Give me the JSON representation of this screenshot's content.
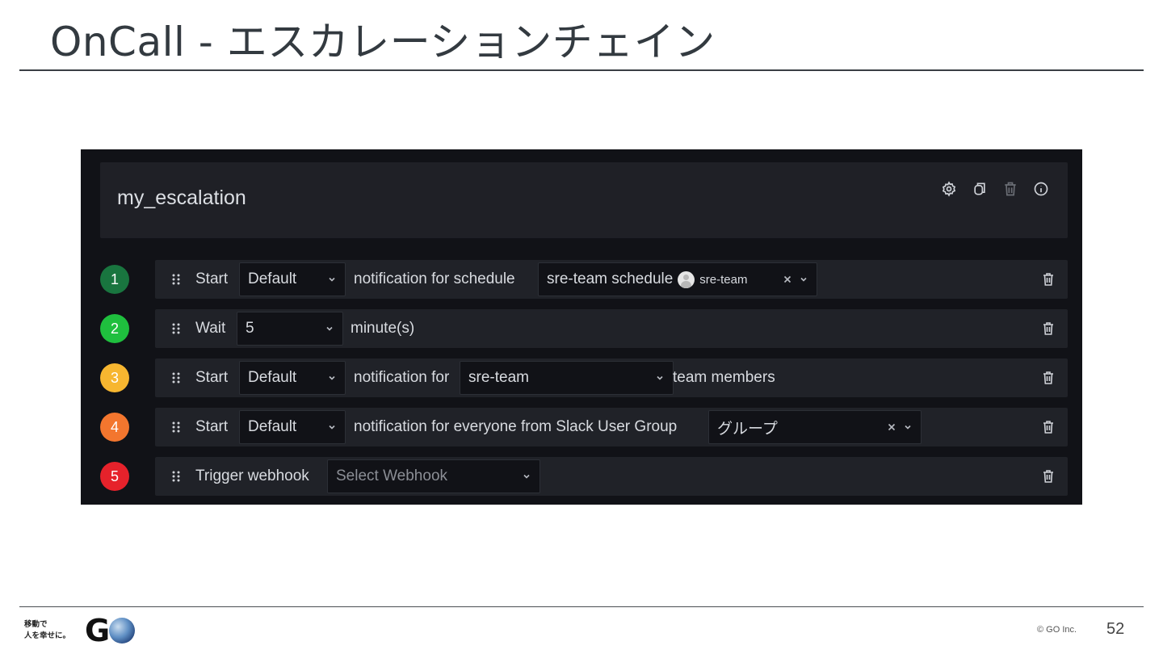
{
  "slide": {
    "title": "OnCall - エスカレーションチェイン",
    "tagline_line1": "移動で",
    "tagline_line2": "人を幸せに。",
    "copyright": "© GO Inc.",
    "page_number": "52"
  },
  "chain": {
    "name": "my_escalation",
    "header_icons": [
      "gear-icon",
      "copy-icon",
      "trash-icon",
      "info-icon"
    ]
  },
  "steps": [
    {
      "number": "1",
      "color": "#19753f",
      "action": "Start",
      "importance": "Default",
      "text": "notification for schedule",
      "target": "sre-team schedule",
      "chip": "sre-team"
    },
    {
      "number": "2",
      "color": "#1fbf3e",
      "action": "Wait",
      "duration": "5",
      "text": "minute(s)"
    },
    {
      "number": "3",
      "color": "#f7b630",
      "action": "Start",
      "importance": "Default",
      "text": "notification for",
      "team": "sre-team",
      "suffix": "team members"
    },
    {
      "number": "4",
      "color": "#f3762e",
      "action": "Start",
      "importance": "Default",
      "text": "notification for everyone from Slack User Group",
      "group": "グループ"
    },
    {
      "number": "5",
      "color": "#e6222b",
      "action": "Trigger webhook",
      "webhook_placeholder": "Select Webhook"
    }
  ],
  "colors": {
    "panel_bg": "#111217",
    "row_bg": "#202228",
    "text": "#d8dbe0"
  }
}
